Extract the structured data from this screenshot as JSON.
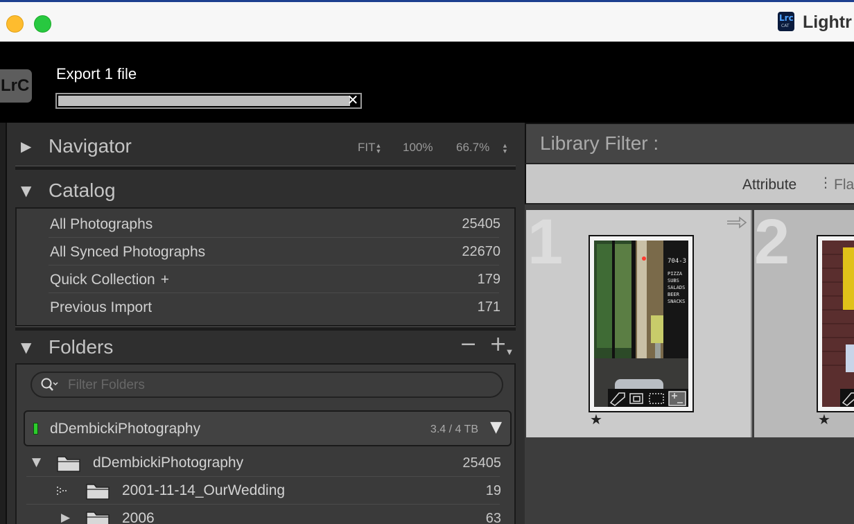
{
  "window": {
    "app_badge_top": "Lrc",
    "app_badge_bottom": "CAT",
    "title": "Lightr"
  },
  "toppanel": {
    "logo": "LrC",
    "export_label": "Export 1 file",
    "export_progress": 0.97
  },
  "navigator": {
    "title": "Navigator",
    "zoom_fit": "FIT",
    "zoom_100": "100%",
    "zoom_custom": "66.7%"
  },
  "catalog": {
    "title": "Catalog",
    "items": [
      {
        "label": "All Photographs",
        "count": "25405"
      },
      {
        "label": "All Synced Photographs",
        "count": "22670"
      },
      {
        "label": "Quick Collection",
        "suffix": "+",
        "count": "179"
      },
      {
        "label": "Previous Import",
        "count": "171"
      }
    ]
  },
  "folders": {
    "title": "Folders",
    "remove_label": "−",
    "add_label": "+",
    "search_placeholder": "Filter Folders",
    "volume": {
      "name": "dDembickiPhotography",
      "size": "3.4 / 4 TB"
    },
    "rows": [
      {
        "name": "dDembickiPhotography",
        "count": "25405"
      },
      {
        "name": "2001-11-14_OurWedding",
        "count": "19"
      },
      {
        "name": "2006",
        "count": "63"
      }
    ]
  },
  "library": {
    "filter_title": "Library Filter :",
    "tab_attribute": "Attribute",
    "tab_flag": "Flag",
    "cells": [
      {
        "index": "1",
        "rating_star": "★"
      },
      {
        "index": "2",
        "rating_star": "★"
      }
    ],
    "sign_text": [
      "704-3",
      "PIZZA",
      "SUBS",
      "SALADS",
      "BEER",
      "SNACKS"
    ]
  },
  "colors": {
    "panel_bg": "#2f2f2f",
    "box_bg": "#3a3a3a",
    "volume_led": "#2ccb2c",
    "grid_selected": "#cbcbcb"
  }
}
